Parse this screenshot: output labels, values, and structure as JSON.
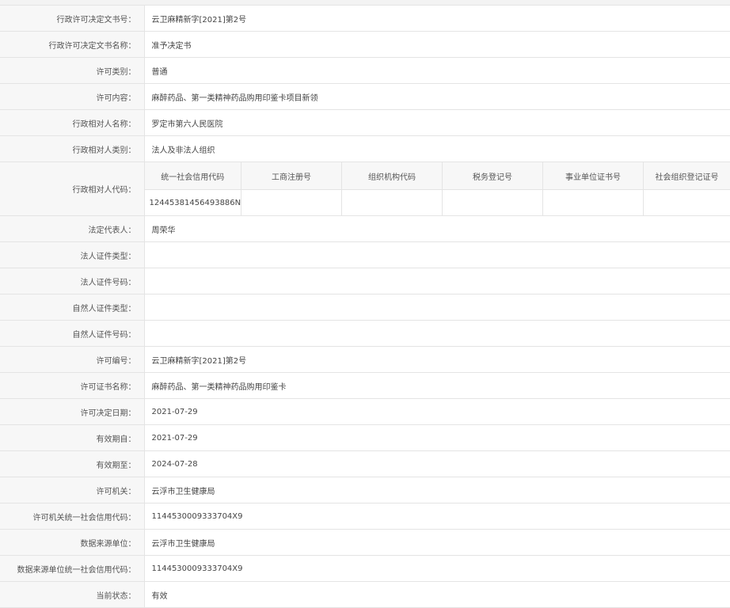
{
  "rows_top": [
    {
      "label": "行政许可决定文书号：",
      "value": "云卫麻精新字[2021]第2号"
    },
    {
      "label": "行政许可决定文书名称：",
      "value": "准予决定书"
    },
    {
      "label": "许可类别：",
      "value": "普通"
    },
    {
      "label": "许可内容：",
      "value": "麻醉药品、第一类精神药品购用印鉴卡项目新领"
    },
    {
      "label": "行政相对人名称：",
      "value": "罗定市第六人民医院"
    },
    {
      "label": "行政相对人类别：",
      "value": "法人及非法人组织"
    }
  ],
  "code_row": {
    "label": "行政相对人代码：",
    "headers": [
      "统一社会信用代码",
      "工商注册号",
      "组织机构代码",
      "税务登记号",
      "事业单位证书号",
      "社会组织登记证号"
    ],
    "values": [
      "12445381456493886N",
      "",
      "",
      "",
      "",
      ""
    ]
  },
  "rows_bottom": [
    {
      "label": "法定代表人：",
      "value": "周荣华"
    },
    {
      "label": "法人证件类型：",
      "value": ""
    },
    {
      "label": "法人证件号码：",
      "value": ""
    },
    {
      "label": "自然人证件类型：",
      "value": ""
    },
    {
      "label": "自然人证件号码：",
      "value": ""
    },
    {
      "label": "许可编号：",
      "value": "云卫麻精新字[2021]第2号"
    },
    {
      "label": "许可证书名称：",
      "value": "麻醉药品、第一类精神药品购用印鉴卡"
    },
    {
      "label": "许可决定日期：",
      "value": "2021-07-29"
    },
    {
      "label": "有效期自：",
      "value": "2021-07-29"
    },
    {
      "label": "有效期至：",
      "value": "2024-07-28"
    },
    {
      "label": "许可机关：",
      "value": "云浮市卫生健康局"
    },
    {
      "label": "许可机关统一社会信用代码：",
      "value": "1144530009333704X9"
    },
    {
      "label": "数据来源单位：",
      "value": "云浮市卫生健康局"
    },
    {
      "label": "数据来源单位统一社会信用代码：",
      "value": "1144530009333704X9"
    },
    {
      "label": "当前状态：",
      "value": "有效"
    }
  ]
}
